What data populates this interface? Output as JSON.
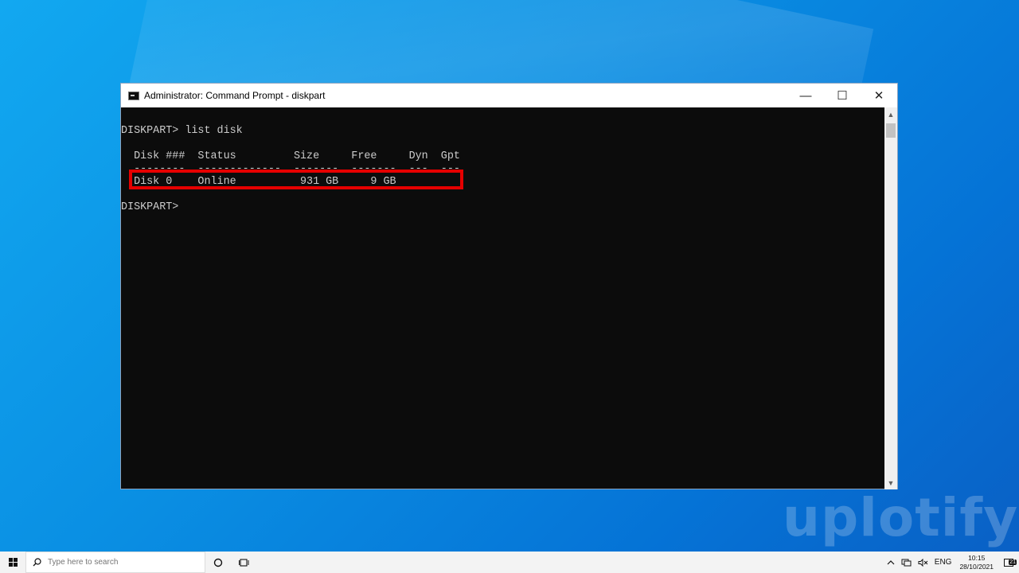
{
  "window": {
    "title": "Administrator: Command Prompt - diskpart",
    "minimize_glyph": "—",
    "maximize_glyph": "☐",
    "close_glyph": "✕"
  },
  "console": {
    "lines": [
      "DISKPART> list disk",
      "",
      "  Disk ###  Status         Size     Free     Dyn  Gpt",
      "  --------  -------------  -------  -------  ---  ---",
      "  Disk 0    Online          931 GB     9 GB",
      "",
      "DISKPART> "
    ],
    "highlight_color": "#e50000"
  },
  "watermark": "uplotify",
  "taskbar": {
    "search_placeholder": "Type here to search",
    "language": "ENG",
    "time": "10:15",
    "date": "28/10/2021",
    "notification_count": "21",
    "icons": {
      "start": "windows-logo",
      "search": "magnifier",
      "cortana": "circle",
      "task_view": "task-view",
      "tray_chevron": "chevron-up",
      "network": "network",
      "volume": "speaker-muted",
      "notifications": "action-center"
    }
  }
}
